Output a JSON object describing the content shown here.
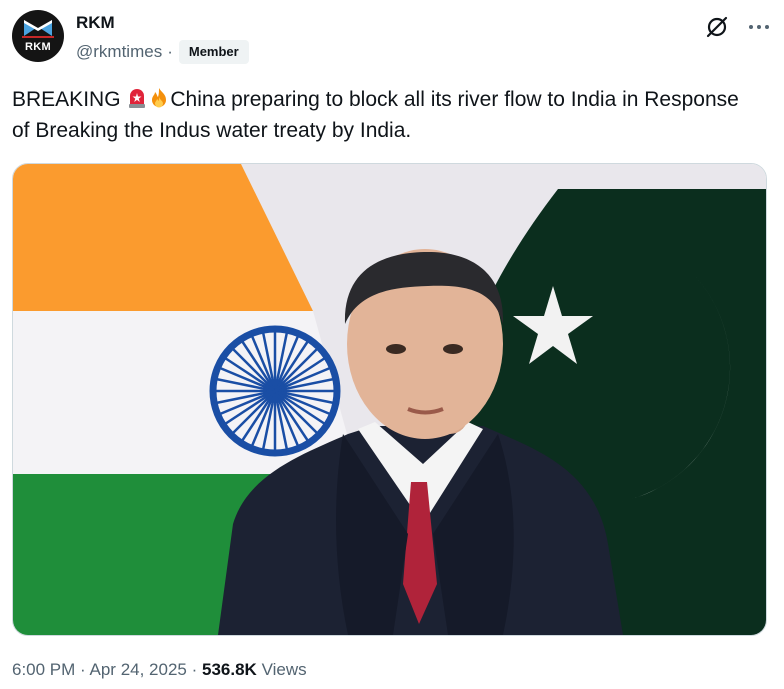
{
  "author": {
    "display_name": "RKM",
    "handle": "@rkmtimes",
    "separator": "·",
    "badge": "Member",
    "avatar_text": "RKM"
  },
  "post": {
    "text_prefix": "BREAKING",
    "text_body": "China preparing to block all its river flow to India in Response of Breaking the Indus water treaty by India.",
    "emojis": [
      "siren-emoji",
      "fire-emoji"
    ]
  },
  "meta": {
    "time": "6:00 PM",
    "sep1": "·",
    "date": "Apr 24, 2025",
    "sep2": "·",
    "views_count": "536.8K",
    "views_label": "Views"
  },
  "icons": {
    "grok": "grok-icon",
    "more": "more-options-icon"
  },
  "colors": {
    "text_primary": "#0f1419",
    "text_secondary": "#536471",
    "badge_bg": "#eff3f4",
    "border": "#cfd9de",
    "india_saffron": "#fb9b2e",
    "india_green": "#1f8e3a",
    "chakra_blue": "#1a4ea5",
    "pakistan_green": "#0b2e1e"
  }
}
